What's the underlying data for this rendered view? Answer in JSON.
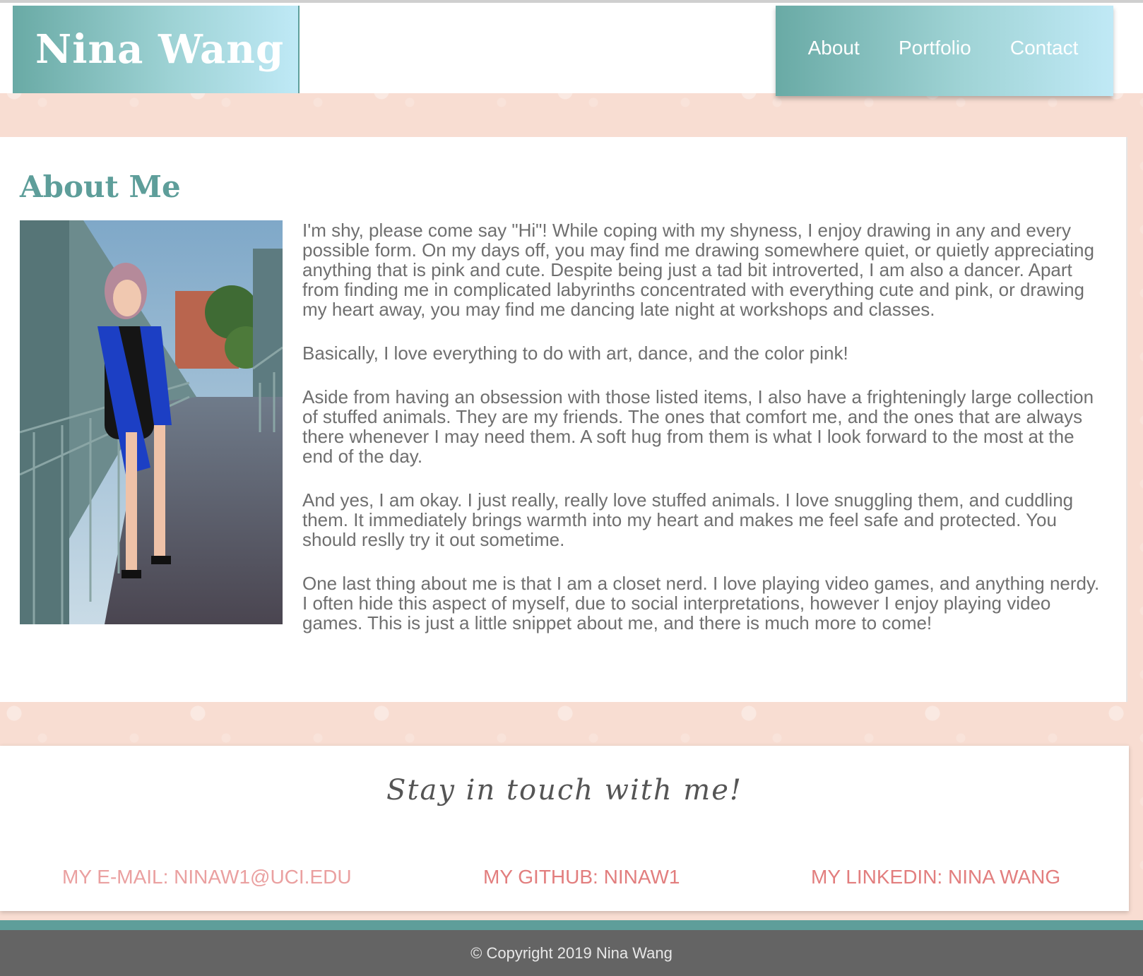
{
  "header": {
    "brand": "Nina Wang",
    "nav": [
      "About",
      "Portfolio",
      "Contact"
    ]
  },
  "about": {
    "title": "About Me",
    "paragraphs": [
      "I'm shy, please come say \"Hi\"! While coping with my shyness, I enjoy drawing in any and every possible form. On my days off, you may find me drawing somewhere quiet, or quietly appreciating anything that is pink and cute. Despite being just a tad bit introverted, I am also a dancer. Apart from finding me in complicated labyrinths concentrated with everything cute and pink, or drawing my heart away, you may find me dancing late night at workshops and classes.",
      "Basically, I love everything to do with art, dance, and the color pink!",
      "Aside from having an obsession with those listed items, I also have a frighteningly large collection of stuffed animals. They are my friends. The ones that comfort me, and the ones that are always there whenever I may need them. A soft hug from them is what I look forward to the most at the end of the day.",
      "And yes, I am okay. I just really, really love stuffed animals. I love snuggling them, and cuddling them. It immediately brings warmth into my heart and makes me feel safe and protected. You should reslly try it out sometime.",
      "One last thing about me is that I am a closet nerd. I love playing video games, and anything nerdy. I often hide this aspect of myself, due to social interpretations, however I enjoy playing video games. This is just a little snippet about me, and there is much more to come!"
    ]
  },
  "contact": {
    "tagline": "Stay in touch with me!",
    "email": "MY E-MAIL: NINAW1@UCI.EDU",
    "github": "MY GITHUB: NINAW1",
    "linkedin": "MY LINKEDIN: NINA WANG"
  },
  "footer": {
    "copyright": "© Copyright 2019 Nina Wang"
  },
  "colors": {
    "accent_teal": "#5e9e9a",
    "link_pink": "#e27e7e",
    "background_pink": "#f8ddd2",
    "footer_gray": "#646464"
  }
}
